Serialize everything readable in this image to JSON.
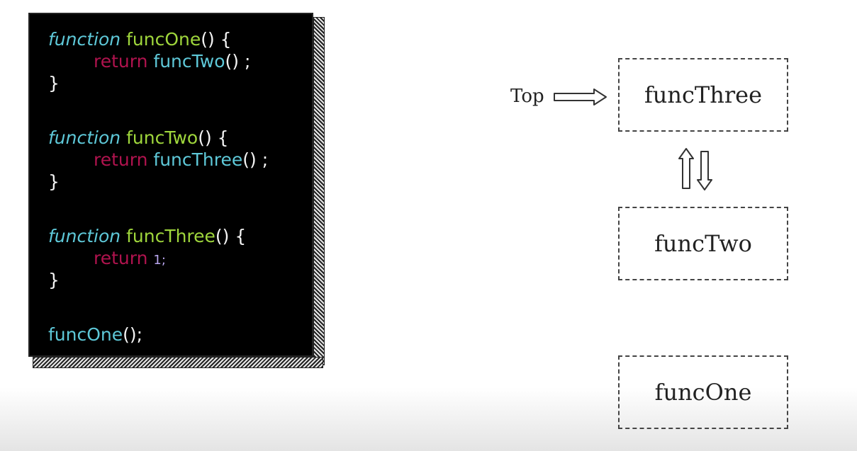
{
  "code": {
    "func_one": {
      "keyword": "function",
      "name": "funcOne",
      "sig_tail": "() {",
      "ret": "return",
      "call": "funcTwo",
      "call_tail": "() ;",
      "close": "}"
    },
    "func_two": {
      "keyword": "function",
      "name": "funcTwo",
      "sig_tail": "() {",
      "ret": "return",
      "call": "funcThree",
      "call_tail": "() ;",
      "close": "}"
    },
    "func_three": {
      "keyword": "function",
      "name": "funcThree",
      "sig_tail": "() {",
      "ret": "return",
      "value": "1;",
      "close": "}"
    },
    "invocation": {
      "call": "funcOne",
      "tail": "();"
    }
  },
  "stack": {
    "top_label": "Top",
    "frames": [
      "funcThree",
      "funcTwo",
      "funcOne"
    ]
  },
  "colors": {
    "keyword": "#5ec8d8",
    "function_name": "#9fd63c",
    "return": "#b0134e",
    "number": "#b9a6ee"
  }
}
